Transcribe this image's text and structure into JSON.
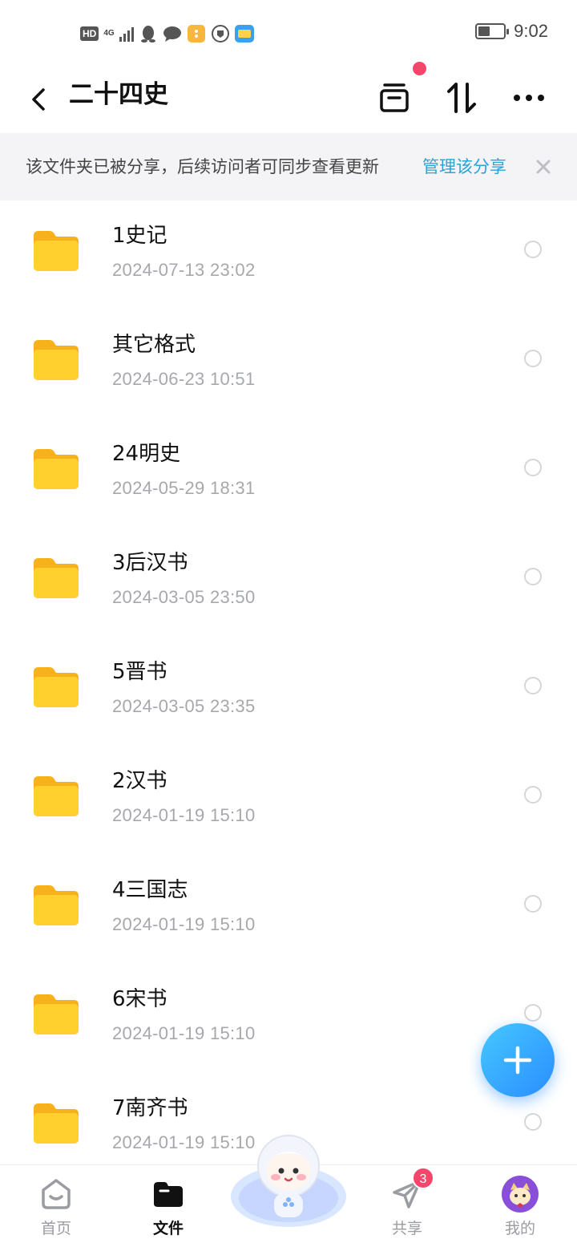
{
  "status_bar": {
    "hd": "HD",
    "network": "4G",
    "time": "9:02",
    "battery_level": 0.45,
    "app_icons": [
      "qq-icon",
      "chat-bubble-icon",
      "orange-app-icon",
      "shield-app-icon",
      "wallet-app-icon"
    ]
  },
  "header": {
    "title": "二十四史",
    "actions": [
      "archive-icon",
      "sort-icon",
      "more-icon"
    ]
  },
  "banner": {
    "text": "该文件夹已被分享，后续访问者可同步查看更新",
    "link": "管理该分享"
  },
  "files": [
    {
      "name": "1史记",
      "date": "2024-07-13  23:02"
    },
    {
      "name": "其它格式",
      "date": "2024-06-23  10:51"
    },
    {
      "name": "24明史",
      "date": "2024-05-29  18:31"
    },
    {
      "name": "3后汉书",
      "date": "2024-03-05  23:50"
    },
    {
      "name": "5晋书",
      "date": "2024-03-05  23:35"
    },
    {
      "name": "2汉书",
      "date": "2024-01-19  15:10"
    },
    {
      "name": "4三国志",
      "date": "2024-01-19  15:10"
    },
    {
      "name": "6宋书",
      "date": "2024-01-19  15:10"
    },
    {
      "name": "7南齐书",
      "date": "2024-01-19  15:10"
    }
  ],
  "nav": {
    "home": "首页",
    "files": "文件",
    "share": "共享",
    "share_badge": "3",
    "me": "我的"
  },
  "colors": {
    "accent": "#2aa3d8",
    "badge": "#f4456a",
    "folder": "#ffc928",
    "fab": "#2a8dff"
  }
}
